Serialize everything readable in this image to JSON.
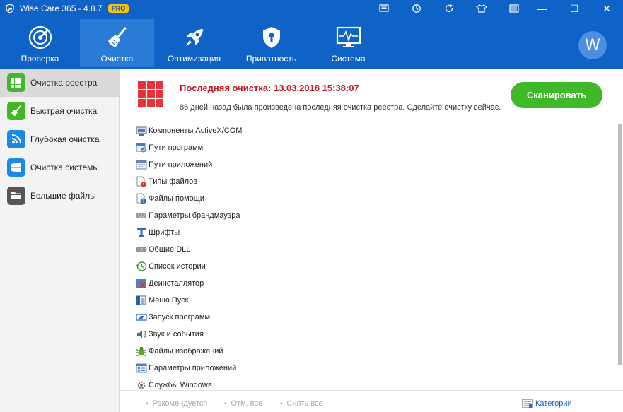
{
  "window": {
    "title": "Wise Care 365 - 4.8.7",
    "badge": "PRO",
    "toolbar_icons": [
      "feedback-icon",
      "history-icon",
      "update-icon",
      "skin-icon",
      "menu-icon"
    ],
    "controls": {
      "minimize": "—",
      "maximize": "☐",
      "close": "✕"
    }
  },
  "nav": {
    "tabs": [
      {
        "label": "Проверка",
        "icon": "radar-icon"
      },
      {
        "label": "Очистка",
        "icon": "broom-icon"
      },
      {
        "label": "Оптимизация",
        "icon": "rocket-icon"
      },
      {
        "label": "Приватность",
        "icon": "shield-icon"
      },
      {
        "label": "Система",
        "icon": "monitor-icon"
      }
    ],
    "active": "Очистка",
    "avatar": "W"
  },
  "sidebar": {
    "items": [
      {
        "label": "Очистка реестра",
        "icon": "registry-grid-icon",
        "color": "#3fb82a"
      },
      {
        "label": "Быстрая очистка",
        "icon": "broom-icon",
        "color": "#3fb82a"
      },
      {
        "label": "Глубокая очистка",
        "icon": "deep-clean-icon",
        "color": "#1e88e5"
      },
      {
        "label": "Очистка системы",
        "icon": "windows-icon",
        "color": "#1e88e5"
      },
      {
        "label": "Большие файлы",
        "icon": "folder-icon",
        "color": "#555555"
      }
    ],
    "active": "Очистка реестра"
  },
  "summary": {
    "last_clean": "Последняя очистка: 13.03.2018 15:38:07",
    "description": "86 дней назад была произведена последняя очистка реестра. Сделайте очистку сейчас.",
    "scan_button": "Сканировать"
  },
  "registry_items": [
    {
      "label": "Компоненты ActiveX/COM",
      "icon": "activex-icon"
    },
    {
      "label": "Пути программ",
      "icon": "program-paths-icon"
    },
    {
      "label": "Пути приложений",
      "icon": "app-paths-icon"
    },
    {
      "label": "Типы файлов",
      "icon": "file-types-icon"
    },
    {
      "label": "Файлы помощи",
      "icon": "help-files-icon"
    },
    {
      "label": "Параметры брандмауэра",
      "icon": "firewall-icon"
    },
    {
      "label": "Шрифты",
      "icon": "fonts-icon"
    },
    {
      "label": "Общие DLL",
      "icon": "dll-icon"
    },
    {
      "label": "Список истории",
      "icon": "history-list-icon"
    },
    {
      "label": "Деинсталлятор",
      "icon": "uninstaller-icon"
    },
    {
      "label": "Меню Пуск",
      "icon": "start-menu-icon"
    },
    {
      "label": "Запуск программ",
      "icon": "startup-icon"
    },
    {
      "label": "Звук и события",
      "icon": "sound-icon"
    },
    {
      "label": "Файлы изображений",
      "icon": "image-files-icon"
    },
    {
      "label": "Параметры приложений",
      "icon": "app-settings-icon"
    },
    {
      "label": "Службы Windows",
      "icon": "services-icon"
    }
  ],
  "footer": {
    "recommended": "Рекомендуется",
    "check_all": "Отм. все",
    "uncheck_all": "Снять все",
    "categories": "Категории"
  }
}
